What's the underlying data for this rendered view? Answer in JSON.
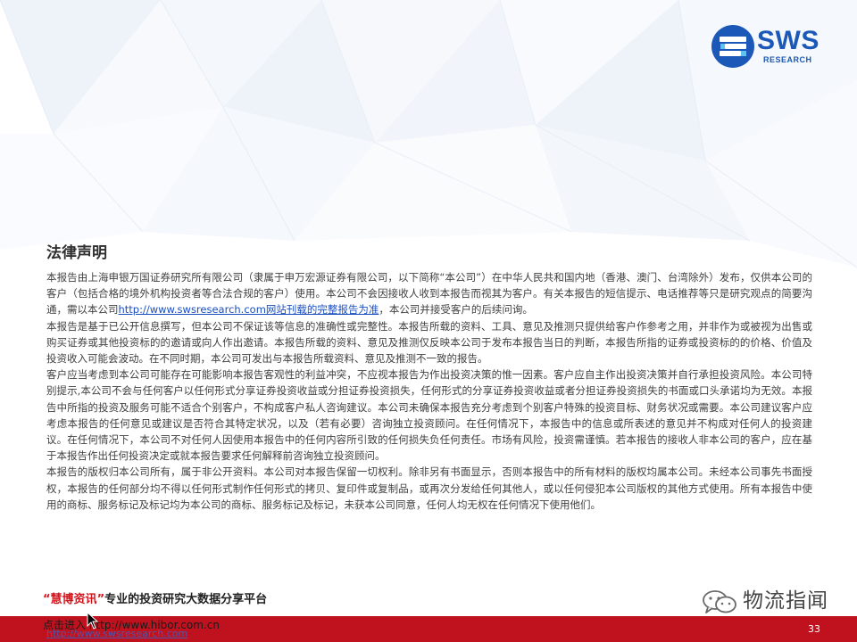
{
  "brand": {
    "logo_text": "SWS",
    "logo_subtext": "RESEARCH",
    "color": "#1b58b8"
  },
  "title": "法律声明",
  "body": {
    "p1_before_link": "本报告由上海申银万国证券研究所有限公司（隶属于申万宏源证券有限公司，以下简称“本公司”）在中华人民共和国内地（香港、澳门、台湾除外）发布，仅供本公司的客户（包括合格的境外机构投资者等合法合规的客户）使用。本公司不会因接收人收到本报告而视其为客户。有关本报告的短信提示、电话推荐等只是研究观点的简要沟通，需以本公司",
    "p1_link": "http://www.swsresearch.com网站刊载的完整报告为准",
    "p1_after_link": "，本公司并接受客户的后续问询。",
    "p2": "本报告是基于已公开信息撰写，但本公司不保证该等信息的准确性或完整性。本报告所载的资料、工具、意见及推测只提供给客户作参考之用，并非作为或被视为出售或购买证券或其他投资标的的邀请或向人作出邀请。本报告所载的资料、意见及推测仅反映本公司于发布本报告当日的判断，本报告所指的证券或投资标的的价格、价值及投资收入可能会波动。在不同时期，本公司可发出与本报告所载资料、意见及推测不一致的报告。",
    "p3": "客户应当考虑到本公司可能存在可能影响本报告客观性的利益冲突，不应视本报告为作出投资决策的惟一因素。客户应自主作出投资决策并自行承担投资风险。本公司特别提示,本公司不会与任何客户以任何形式分享证券投资收益或分担证券投资损失，任何形式的分享证券投资收益或者分担证券投资损失的书面或口头承诺均为无效。本报告中所指的投资及服务可能不适合个别客户，不构成客户私人咨询建议。本公司未确保本报告充分考虑到个别客户特殊的投资目标、财务状况或需要。本公司建议客户应考虑本报告的任何意见或建议是否符合其特定状况，以及（若有必要）咨询独立投资顾问。在任何情况下，本报告中的信息或所表述的意见并不构成对任何人的投资建议。在任何情况下，本公司不对任何人因使用本报告中的任何内容所引致的任何损失负任何责任。市场有风险，投资需谨慎。若本报告的接收人非本公司的客户，应在基于本报告作出任何投资决定或就本报告要求任何解释前咨询独立投资顾问。",
    "p4": "本报告的版权归本公司所有，属于非公开资料。本公司对本报告保留一切权利。除非另有书面显示，否则本报告中的所有材料的版权均属本公司。未经本公司事先书面授权，本报告的任何部分均不得以任何形式制作任何形式的拷贝、复印件或复制品，或再次分发给任何其他人，或以任何侵犯本公司版权的其他方式使用。所有本报告中使用的商标、服务标记及标记均为本公司的商标、服务标记及标记，未获本公司同意，任何人均无权在任何情况下使用他们。"
  },
  "promo": {
    "open_quote": "“",
    "brand_name": "慧博资讯",
    "close_quote": "”",
    "tagline": "专业的投资研究大数据分享平台"
  },
  "footer": {
    "link_text": "点击进入 http://www.hibor.com.cn",
    "link_text_dup": "http://www.swsresearch.com",
    "page_number": "33",
    "bar_color": "#c0121e"
  },
  "wechat": {
    "account_name": "物流指闻"
  }
}
